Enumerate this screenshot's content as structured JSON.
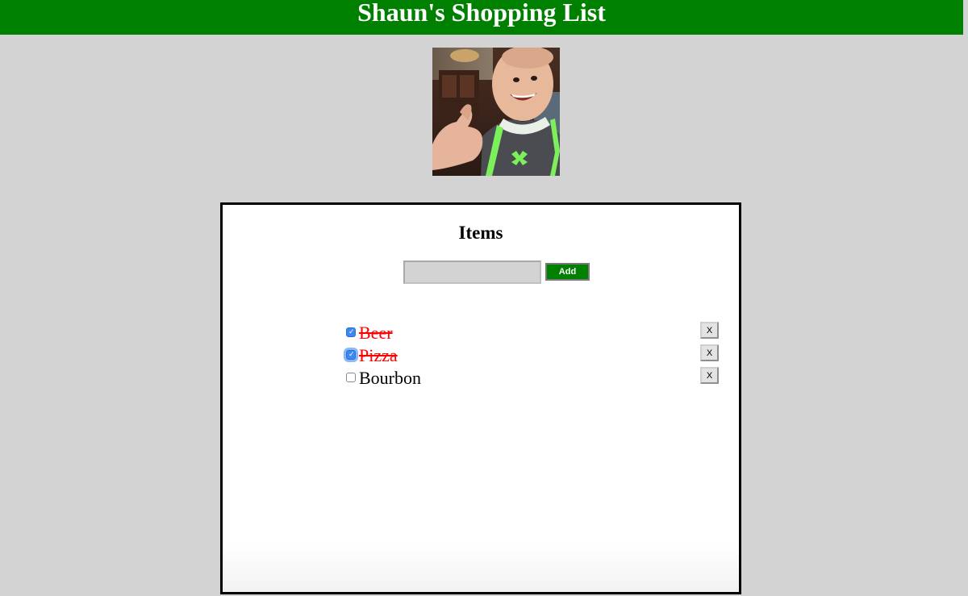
{
  "header": {
    "title": "Shaun's Shopping List"
  },
  "profile_photo": {
    "icon": "profile-photo"
  },
  "panel": {
    "title": "Items",
    "input": {
      "value": "",
      "placeholder": ""
    },
    "add_label": "Add",
    "items": [
      {
        "label": "Beer",
        "checked": true,
        "remove_label": "X"
      },
      {
        "label": "Pizza",
        "checked": true,
        "remove_label": "X"
      },
      {
        "label": "Bourbon",
        "checked": false,
        "remove_label": "X"
      }
    ]
  },
  "colors": {
    "header_bg": "#008000",
    "page_bg": "#d3d3d3",
    "done_text": "#ff0000",
    "checkbox_checked": "#3b89f0"
  }
}
